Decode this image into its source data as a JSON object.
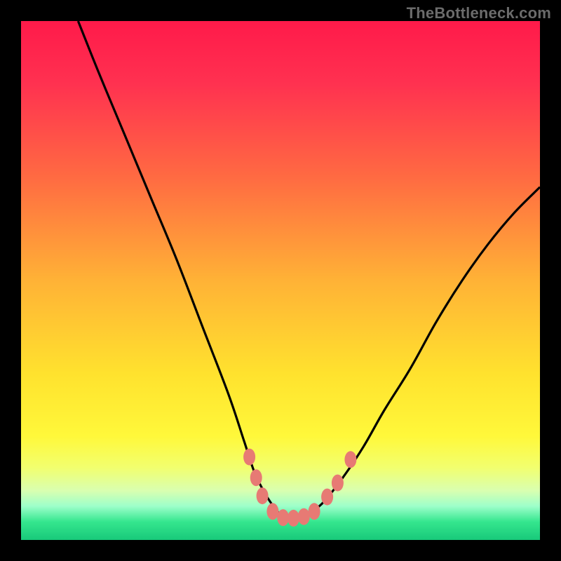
{
  "watermark": {
    "text": "TheBottleneck.com"
  },
  "chart_data": {
    "type": "line",
    "title": "",
    "xlabel": "",
    "ylabel": "",
    "xlim": [
      0,
      100
    ],
    "ylim": [
      0,
      100
    ],
    "grid": false,
    "legend": false,
    "annotations": [],
    "background_gradient_stops": [
      {
        "pos": 0.0,
        "color": "#ff1a4a"
      },
      {
        "pos": 0.12,
        "color": "#ff3150"
      },
      {
        "pos": 0.3,
        "color": "#ff6a42"
      },
      {
        "pos": 0.5,
        "color": "#ffb236"
      },
      {
        "pos": 0.68,
        "color": "#ffe22e"
      },
      {
        "pos": 0.8,
        "color": "#fff83a"
      },
      {
        "pos": 0.86,
        "color": "#f2ff6e"
      },
      {
        "pos": 0.905,
        "color": "#d9ffb0"
      },
      {
        "pos": 0.935,
        "color": "#9dffca"
      },
      {
        "pos": 0.965,
        "color": "#35e68e"
      },
      {
        "pos": 1.0,
        "color": "#18c97a"
      }
    ],
    "series": [
      {
        "name": "bottleneck-curve",
        "color": "#000000",
        "x": [
          11,
          15,
          20,
          25,
          30,
          35,
          40,
          43,
          45,
          47,
          49,
          51,
          53,
          55,
          58,
          62,
          66,
          70,
          75,
          80,
          85,
          90,
          95,
          100
        ],
        "y": [
          100,
          90,
          78,
          66,
          54,
          41,
          28,
          19,
          13,
          9,
          6,
          4,
          4,
          5,
          7,
          12,
          18,
          25,
          33,
          42,
          50,
          57,
          63,
          68
        ]
      }
    ],
    "markers": {
      "name": "highlight-dots",
      "color": "#e77a74",
      "points": [
        {
          "x": 44.0,
          "y": 16.0
        },
        {
          "x": 45.3,
          "y": 12.0
        },
        {
          "x": 46.5,
          "y": 8.5
        },
        {
          "x": 48.5,
          "y": 5.5
        },
        {
          "x": 50.5,
          "y": 4.3
        },
        {
          "x": 52.5,
          "y": 4.2
        },
        {
          "x": 54.5,
          "y": 4.5
        },
        {
          "x": 56.5,
          "y": 5.5
        },
        {
          "x": 59.0,
          "y": 8.3
        },
        {
          "x": 61.0,
          "y": 11.0
        },
        {
          "x": 63.5,
          "y": 15.5
        }
      ]
    }
  }
}
